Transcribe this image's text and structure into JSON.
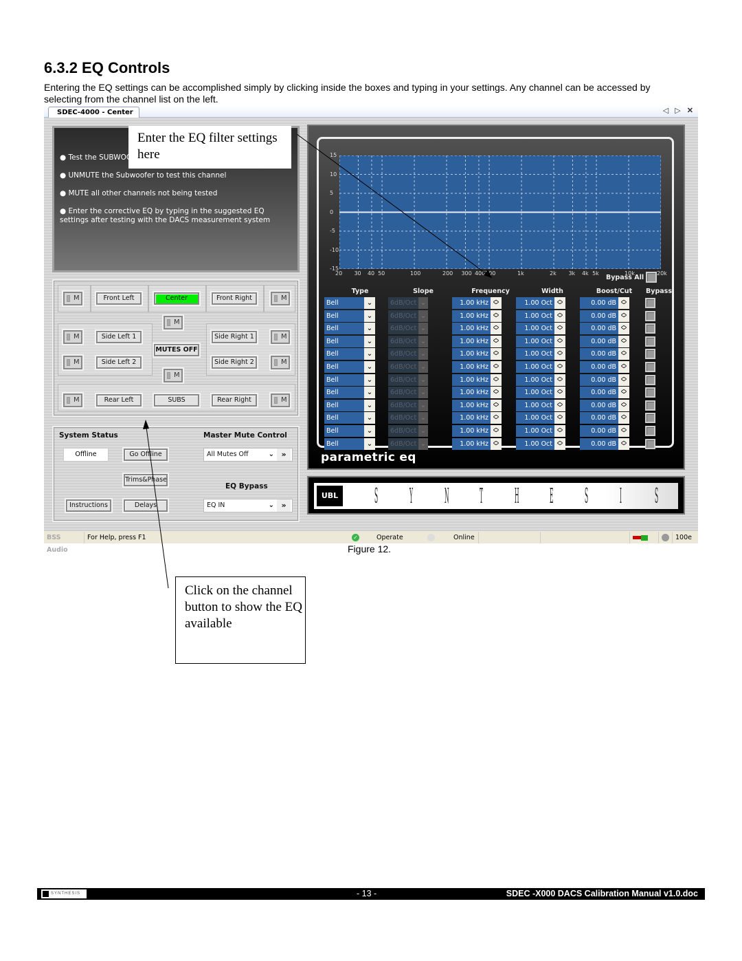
{
  "document": {
    "section_title": "6.3.2 EQ Controls",
    "intro": "Entering the EQ settings can be accomplished simply by clicking inside the boxes and typing in your settings. Any channel can be accessed by selecting from the channel list on the left.",
    "figure_caption": "Figure 12.",
    "callouts": {
      "eq_filter": "Enter the EQ filter settings here",
      "channel_button": "Click on the channel button to show the EQ available"
    },
    "footer": {
      "logo": "SYNTHESIS",
      "page": "- 13 -",
      "doc_name": "SDEC -X000 DACS Calibration Manual v1.0.doc"
    }
  },
  "app": {
    "tab_label": "SDEC-4000 - Center",
    "window_controls": [
      "◁",
      "▷",
      "✕"
    ],
    "instructions": [
      "● Test the SUBWOOFER",
      "● UNMUTE the Subwoofer to test this channel",
      "● MUTE all other channels not being tested",
      "● Enter the corrective EQ by typing in the suggested EQ settings after testing with the DACS measurement system"
    ],
    "channels": {
      "front_left": "Front Left",
      "center": "Center",
      "front_right": "Front Right",
      "side_left_1": "Side Left 1",
      "side_right_1": "Side Right 1",
      "side_left_2": "Side Left 2",
      "side_right_2": "Side Right 2",
      "mutes_off": "MUTES OFF",
      "rear_left": "Rear Left",
      "subs": "SUBS",
      "rear_right": "Rear Right",
      "mute_label": "M",
      "active_color": "#00ee00"
    },
    "system_status": {
      "heading": "System Status",
      "state": "Offline",
      "go_offline": "Go Offline",
      "trims_phase": "Trims&Phase",
      "instructions": "Instructions",
      "delays": "Delays"
    },
    "master_mute": {
      "heading": "Master Mute Control",
      "value": "All Mutes Off"
    },
    "eq_bypass": {
      "heading": "EQ Bypass",
      "value": "EQ IN"
    },
    "eq": {
      "title": "parametric eq",
      "bypass_all": "Bypass All",
      "columns": [
        "Type",
        "Slope",
        "Frequency",
        "Width",
        "Boost/Cut",
        "Bypass"
      ],
      "bands": [
        {
          "type": "Bell",
          "slope": "6dB/Oct",
          "freq": "1.00 kHz",
          "width": "1.00 Oct",
          "gain": "0.00 dB",
          "bypass": false
        },
        {
          "type": "Bell",
          "slope": "6dB/Oct",
          "freq": "1.00 kHz",
          "width": "1.00 Oct",
          "gain": "0.00 dB",
          "bypass": false
        },
        {
          "type": "Bell",
          "slope": "6dB/Oct",
          "freq": "1.00 kHz",
          "width": "1.00 Oct",
          "gain": "0.00 dB",
          "bypass": false
        },
        {
          "type": "Bell",
          "slope": "6dB/Oct",
          "freq": "1.00 kHz",
          "width": "1.00 Oct",
          "gain": "0.00 dB",
          "bypass": false
        },
        {
          "type": "Bell",
          "slope": "6dB/Oct",
          "freq": "1.00 kHz",
          "width": "1.00 Oct",
          "gain": "0.00 dB",
          "bypass": false
        },
        {
          "type": "Bell",
          "slope": "6dB/Oct",
          "freq": "1.00 kHz",
          "width": "1.00 Oct",
          "gain": "0.00 dB",
          "bypass": false
        },
        {
          "type": "Bell",
          "slope": "6dB/Oct",
          "freq": "1.00 kHz",
          "width": "1.00 Oct",
          "gain": "0.00 dB",
          "bypass": false
        },
        {
          "type": "Bell",
          "slope": "6dB/Oct",
          "freq": "1.00 kHz",
          "width": "1.00 Oct",
          "gain": "0.00 dB",
          "bypass": false
        },
        {
          "type": "Bell",
          "slope": "6dB/Oct",
          "freq": "1.00 kHz",
          "width": "1.00 Oct",
          "gain": "0.00 dB",
          "bypass": false
        },
        {
          "type": "Bell",
          "slope": "6dB/Oct",
          "freq": "1.00 kHz",
          "width": "1.00 Oct",
          "gain": "0.00 dB",
          "bypass": false
        },
        {
          "type": "Bell",
          "slope": "6dB/Oct",
          "freq": "1.00 kHz",
          "width": "1.00 Oct",
          "gain": "0.00 dB",
          "bypass": false
        },
        {
          "type": "Bell",
          "slope": "6dB/Oct",
          "freq": "1.00 kHz",
          "width": "1.00 Oct",
          "gain": "0.00 dB",
          "bypass": false
        }
      ],
      "plot": {
        "x_ticks": [
          20,
          30,
          40,
          50,
          100,
          200,
          300,
          400,
          500,
          1000,
          2000,
          3000,
          4000,
          5000,
          10000,
          20000
        ],
        "x_tick_labels": [
          "20",
          "30",
          "40",
          "50",
          "100",
          "200",
          "300",
          "400",
          "500",
          "1k",
          "2k",
          "3k",
          "4k",
          "5k",
          "10k",
          "20k"
        ],
        "y_ticks": [
          15,
          10,
          5,
          0,
          -5,
          -10,
          -15
        ],
        "xlim": [
          20,
          20000
        ],
        "ylim": [
          -15,
          15
        ],
        "response_db": 0,
        "bg_color": "#2d5f9a"
      }
    },
    "brand": {
      "logo": "UBL",
      "letters": [
        "S",
        "Y",
        "N",
        "T",
        "H",
        "E",
        "S",
        "I",
        "S"
      ]
    },
    "statusbar": {
      "vendor": "BSS Audio",
      "help": "For Help, press F1",
      "operate": "Operate",
      "online": "Online",
      "zoom": "100e"
    }
  }
}
